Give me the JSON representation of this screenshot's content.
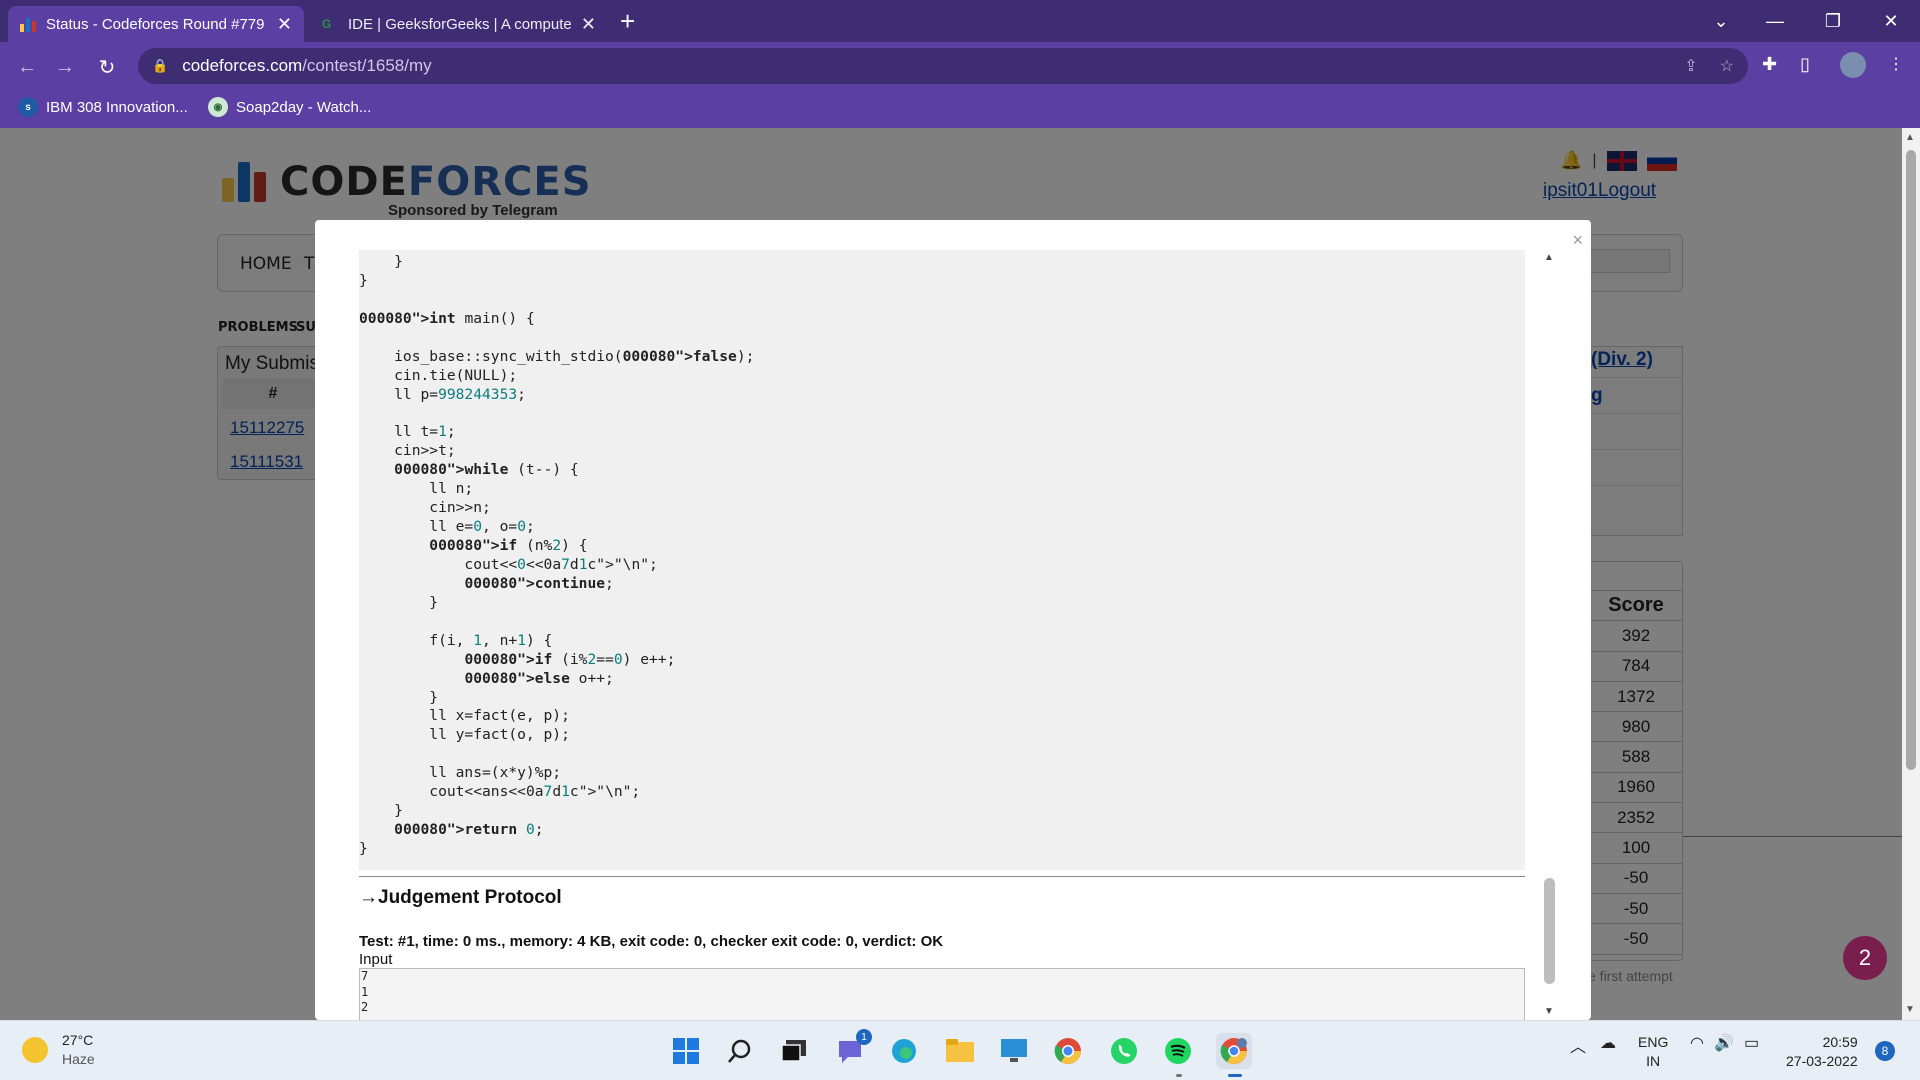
{
  "browser": {
    "tabs": [
      {
        "title": "Status - Codeforces Round #779",
        "active": true
      },
      {
        "title": "IDE | GeeksforGeeks | A compute",
        "active": false
      }
    ],
    "url": {
      "host": "codeforces.com",
      "path": "/contest/1658/my"
    },
    "bookmarks": [
      {
        "label": "IBM 308 Innovation..."
      },
      {
        "label": "Soap2day - Watch..."
      }
    ],
    "colors": {
      "frame": "#3f2d73",
      "toolbar": "#5b3fa3"
    }
  },
  "site": {
    "logo_left": "CODE",
    "logo_right": "FORCES",
    "sponsor": "Sponsored by Telegram",
    "user": "ipsit01",
    "logout": "Logout",
    "menu": [
      "HOME",
      "TO"
    ],
    "subnav": [
      "PROBLEMS",
      "SUB"
    ],
    "submissions": {
      "title": "My Submis",
      "header": "#",
      "ids": [
        "15112275",
        "15111531"
      ]
    },
    "contest_link": "(Div. 2)",
    "contest_link2": "g",
    "score_header": "Score",
    "scores": [
      "392",
      "784",
      "1372",
      "980",
      "588",
      "1960",
      "2352",
      "100",
      "-50",
      "-50",
      "-50"
    ],
    "first_attempt": "e first attempt",
    "help_count": "2"
  },
  "modal": {
    "close": "×",
    "code_lines": [
      "        }",
      "    }",
      "}",
      "",
      "int main() {",
      "",
      "    ios_base::sync_with_stdio(false);",
      "    cin.tie(NULL);",
      "    ll p=998244353;",
      "",
      "    ll t=1;",
      "    cin>>t;",
      "    while (t--) {",
      "        ll n;",
      "        cin>>n;",
      "        ll e=0, o=0;",
      "        if (n%2) {",
      "            cout<<0<<\"\\n\";",
      "            continue;",
      "        }",
      "",
      "        f(i, 1, n+1) {",
      "            if (i%2==0) e++;",
      "            else o++;",
      "        }",
      "        ll x=fact(e, p);",
      "        ll y=fact(o, p);",
      "",
      "        ll ans=(x*y)%p;",
      "        cout<<ans<<\"\\n\";",
      "    }",
      "    return 0;",
      "}"
    ],
    "judgement_title": "→Judgement Protocol",
    "test_line": "Test: #1, time: 0 ms., memory: 4 KB, exit code: 0, checker exit code: 0, verdict: OK",
    "input_label": "Input",
    "input_lines": [
      "7",
      "1",
      "2"
    ]
  },
  "taskbar": {
    "temperature": "27°C",
    "weather": "Haze",
    "teams_badge": "1",
    "lang_line1": "ENG",
    "lang_line2": "IN",
    "time": "20:59",
    "date": "27-03-2022",
    "notifications": "8"
  }
}
